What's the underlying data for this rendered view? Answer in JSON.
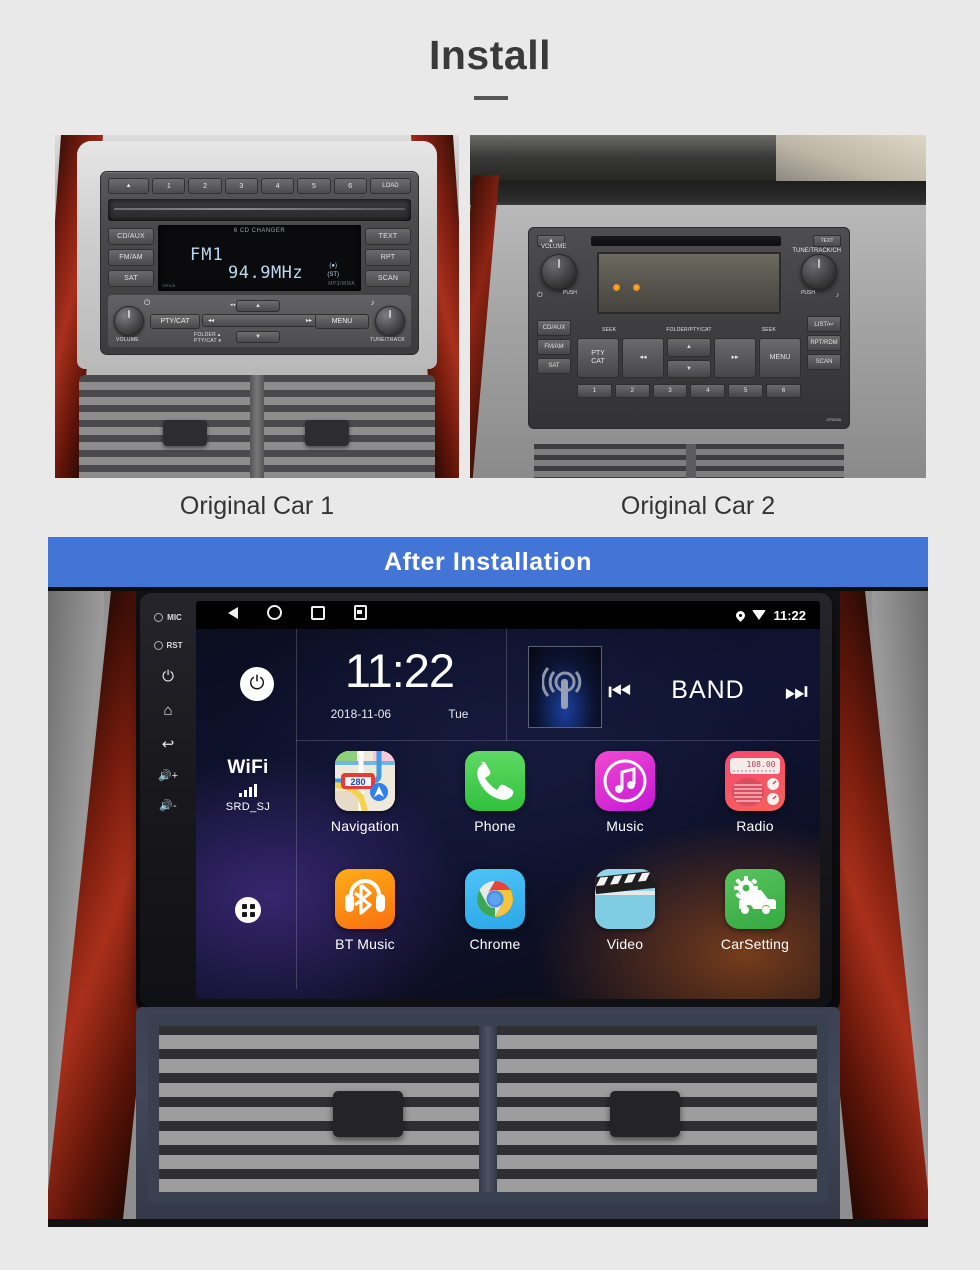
{
  "header": {
    "title": "Install"
  },
  "comparison": {
    "left_caption": "Original Car 1",
    "right_caption": "Original Car 2",
    "banner": "After  Installation"
  },
  "original_car_1": {
    "top_buttons": [
      "▲",
      "1",
      "2",
      "3",
      "4",
      "5",
      "6",
      "LOAD"
    ],
    "left_buttons": [
      "CD/AUX",
      "FM/AM",
      "SAT"
    ],
    "right_buttons": [
      "TEXT",
      "RPT",
      "SCAN"
    ],
    "right_small_label": "RDM",
    "display": {
      "header": "6 CD CHANGER",
      "source": "FM1",
      "frequency": "94.9MHz",
      "stereo_indicator": "(●)",
      "stereo_label": "(ST)",
      "bottom_left": "SIRIUS®\nSATELLITE",
      "bottom_right": "MP3/WMA"
    },
    "controls": {
      "pty_cat": "PTY/CAT",
      "menu": "MENU",
      "seek_label": "◂◂ SEEK ▸▸",
      "seek_back": "◂◂",
      "seek_forward": "▸▸",
      "up": "▲",
      "down": "▼",
      "volume_label": "VOLUME",
      "tune_label": "TUNE/TRACK",
      "folder_label": "FOLDER ▴\nPTY/CAT ▾",
      "power_glyph": "⏻",
      "music_glyph": "♪"
    }
  },
  "original_car_2": {
    "eject": "▲",
    "text_button": "TEXT",
    "volume_label": "VOLUME",
    "tune_label": "TUNE/TRACK/CH",
    "push_label": "PUSH",
    "power_glyph": "⏻",
    "music_glyph": "♪",
    "left_buttons": [
      "CD/AUX",
      "FM/AM",
      "SAT"
    ],
    "right_buttons": [
      "LIST/↩",
      "RPT/RDM",
      "SCAN"
    ],
    "main_buttons": [
      "PTY\nCAT",
      "◂◂",
      "▲",
      "▼",
      "▸▸",
      "MENU"
    ],
    "seek_labels": [
      "SEEK",
      "FOLDER/PTY/CAT",
      "SEEK"
    ],
    "presets": [
      "1",
      "2",
      "3",
      "4",
      "5",
      "6"
    ],
    "model_code": "CP6250"
  },
  "head_unit": {
    "hardware_buttons": [
      {
        "name": "MIC",
        "label": "MIC",
        "type": "ring"
      },
      {
        "name": "RST",
        "label": "RST",
        "type": "ring"
      },
      {
        "name": "power",
        "label": "⏻",
        "type": "icon"
      },
      {
        "name": "home",
        "label": "⌂",
        "type": "icon"
      },
      {
        "name": "back",
        "label": "↩",
        "type": "icon"
      },
      {
        "name": "volume-up",
        "label": "🔊+",
        "type": "icon"
      },
      {
        "name": "volume-down",
        "label": "🔊-",
        "type": "icon"
      }
    ],
    "status_bar": {
      "nav_icons": [
        "back-icon",
        "home-icon",
        "recents-icon",
        "screenshot-icon"
      ],
      "location_icon": "location-pin-icon",
      "wifi_icon": "wifi-icon",
      "time": "11:22"
    },
    "widget": {
      "power_glyph": "⏻",
      "clock": "11:22",
      "date": "2018-11-06",
      "weekday": "Tue",
      "media_prev": "⏮",
      "media_band": "BAND",
      "media_next": "⏭"
    },
    "wifi": {
      "title": "WiFi",
      "ssid": "SRD_SJ",
      "bars": [
        4,
        7,
        10,
        13
      ]
    },
    "apps": [
      {
        "label": "Navigation",
        "icon": "navigation-icon",
        "badge": "280"
      },
      {
        "label": "Phone",
        "icon": "phone-icon"
      },
      {
        "label": "Music",
        "icon": "music-icon"
      },
      {
        "label": "Radio",
        "icon": "radio-icon",
        "badge": "108.00"
      },
      {
        "label": "BT Music",
        "icon": "bluetooth-music-icon"
      },
      {
        "label": "Chrome",
        "icon": "chrome-icon"
      },
      {
        "label": "Video",
        "icon": "video-icon"
      },
      {
        "label": "CarSetting",
        "icon": "car-setting-icon"
      }
    ],
    "app_drawer_icon": "app-grid-icon"
  },
  "colors": {
    "page_bg": "#e9e9e9",
    "banner_blue": "#4275d6",
    "title_gray": "#3a3a3a",
    "phone_green": "#3ec84a",
    "music_magenta": "#d62ad2",
    "radio_pink": "#f6546a",
    "bt_orange": "#f98a13",
    "chrome_blue": "#34b3ef",
    "video_cyan": "#84d2e8",
    "car_green": "#42b44c"
  }
}
